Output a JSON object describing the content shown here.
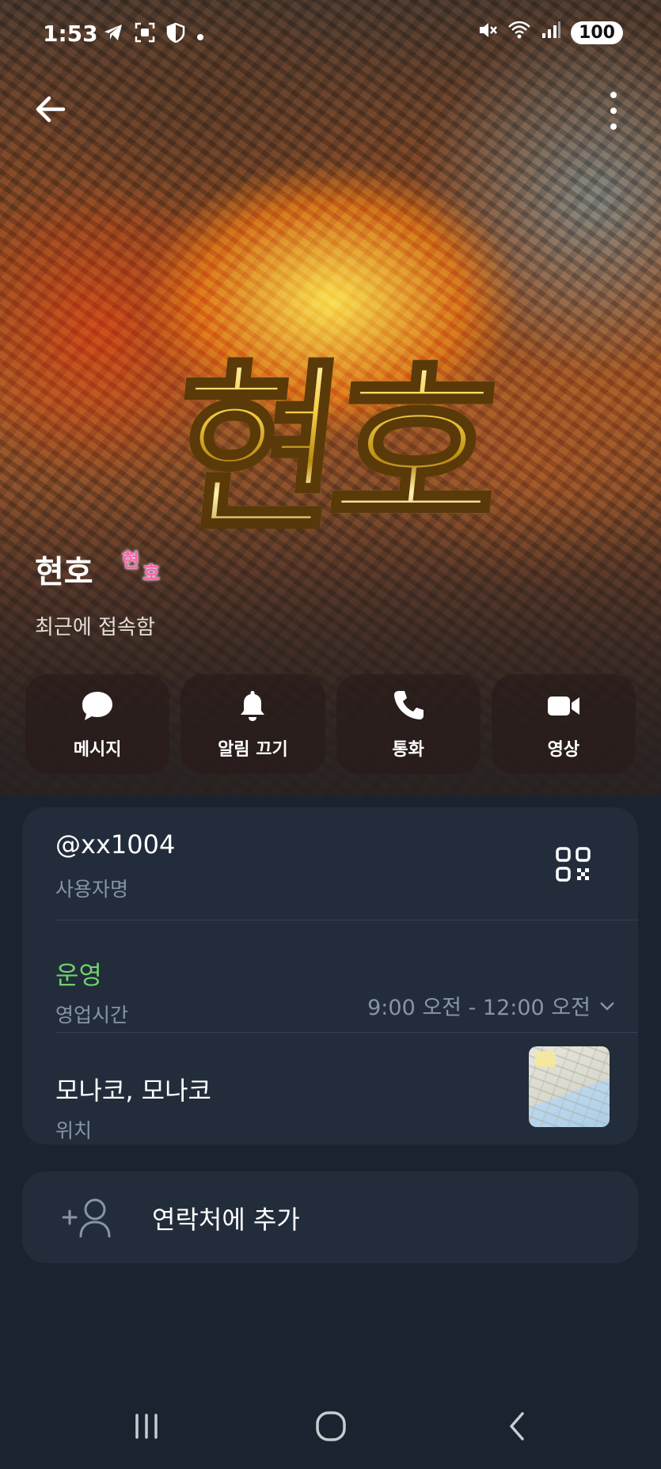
{
  "status_bar": {
    "time": "1:53",
    "battery": "100",
    "left_icons": [
      "telegram-icon",
      "screenshot-icon",
      "shield-icon",
      "dot-icon"
    ],
    "right_icons": [
      "mute-icon",
      "wifi-icon",
      "signal-icon"
    ]
  },
  "header": {
    "cover_title": "현호",
    "name": "현호",
    "sticker": [
      "현",
      "호"
    ],
    "last_seen": "최근에 접속함"
  },
  "actions": [
    {
      "label": "메시지",
      "icon": "message-icon"
    },
    {
      "label": "알림 끄기",
      "icon": "bell-icon"
    },
    {
      "label": "통화",
      "icon": "phone-icon"
    },
    {
      "label": "영상",
      "icon": "video-icon"
    }
  ],
  "info": {
    "username": "@xx1004",
    "username_caption": "사용자명",
    "status": "운영",
    "hours_caption": "영업시간",
    "hours": "9:00 오전 - 12:00 오전",
    "location": "모나코, 모나코",
    "location_caption": "위치"
  },
  "add_contact": {
    "label": "연락처에 추가"
  },
  "colors": {
    "background": "#1a2330",
    "card": "#222c3a",
    "open_status": "#6fd16f",
    "secondary_text": "#8a95a3"
  }
}
